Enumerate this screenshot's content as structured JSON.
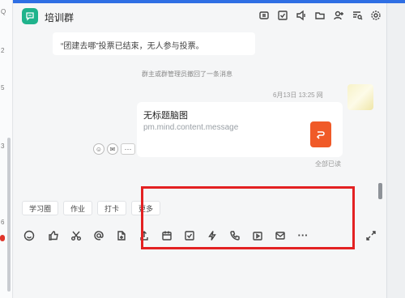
{
  "app": {
    "accent_color": "#2f6fe4",
    "group_icon_color": "#1fb38c",
    "highlight_box_color": "#e32122"
  },
  "left_strip": {
    "ticks": [
      "Q",
      "2",
      "5",
      "3",
      "6"
    ]
  },
  "header": {
    "title": "培训群",
    "icons": [
      "screen-share-icon",
      "todo-icon",
      "announce-icon",
      "folder-icon",
      "add-member-icon",
      "search-history-icon",
      "settings-icon"
    ]
  },
  "messages": {
    "vote_notice": "“团建去哪”投票已结束，无人参与投票。",
    "system_notice": "群主或群管理员撤回了一条消息",
    "meta": "6月13日 13:25 网",
    "card_title": "无标题脑图",
    "card_subtitle": "pm.mind.content.message",
    "read_status": "全部已读",
    "more_label": "···"
  },
  "quick_tabs": [
    "学习圈",
    "作业",
    "打卡",
    "更多"
  ],
  "toolbar": {
    "icons": [
      "emoji-icon",
      "like-icon",
      "scissors-icon",
      "mention-icon",
      "file-icon",
      "upload-icon",
      "calendar-icon",
      "task-icon",
      "flash-icon",
      "call-icon",
      "video-icon",
      "mail-icon",
      "more-icon",
      "expand-icon"
    ],
    "more_label": "···"
  }
}
